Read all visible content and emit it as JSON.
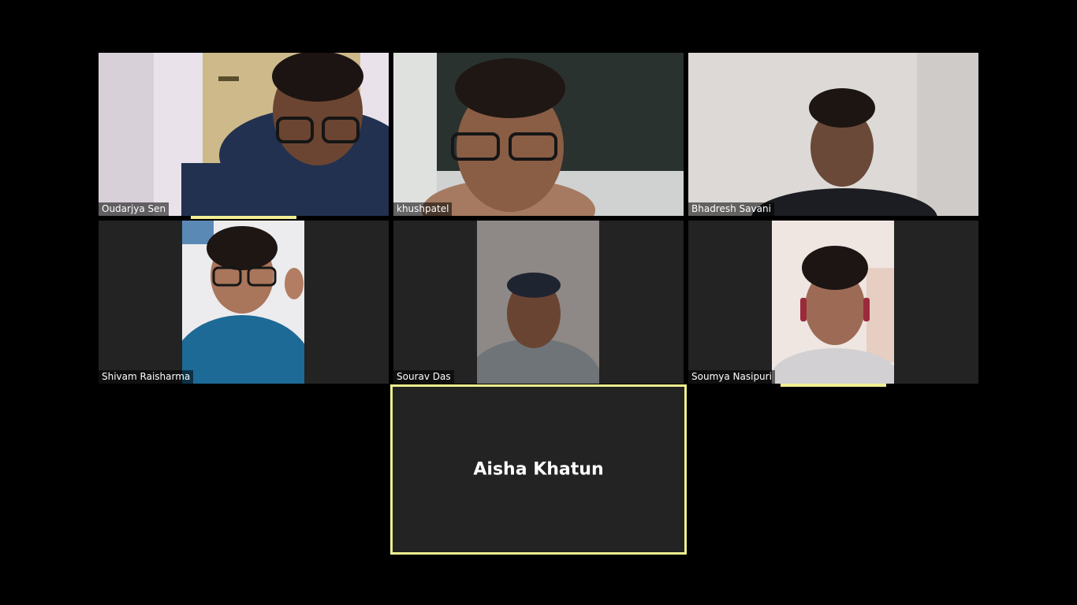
{
  "participants": [
    {
      "name": "Oudarjya Sen"
    },
    {
      "name": "khushpatel"
    },
    {
      "name": "Bhadresh Savani"
    },
    {
      "name": "Shivam Raisharma"
    },
    {
      "name": "Sourav Das"
    },
    {
      "name": "Soumya Nasipuri"
    },
    {
      "name": "Aisha Khatun"
    }
  ],
  "colors": {
    "background": "#000000",
    "tile": "#232323",
    "active_speaker_border": "#eef18f",
    "speaking_indicator": "#f2ee94"
  }
}
